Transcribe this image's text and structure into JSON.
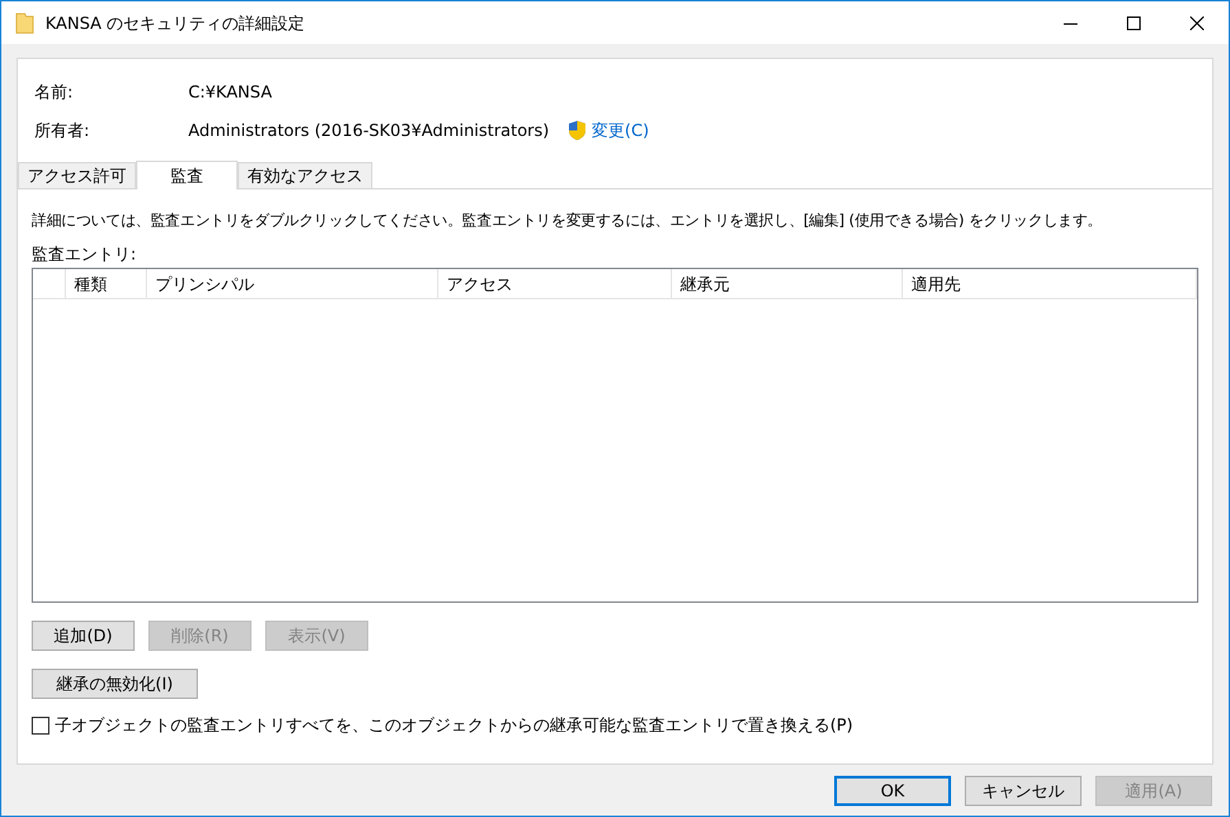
{
  "window": {
    "title": "KANSA のセキュリティの詳細設定"
  },
  "properties": [
    {
      "label": "名前:",
      "value": "C:¥KANSA"
    },
    {
      "label": "所有者:",
      "value": "Administrators (2016-SK03¥Administrators)",
      "link": "変更(C)"
    }
  ],
  "tabs": [
    {
      "label": "アクセス許可",
      "selected": false
    },
    {
      "label": "監査",
      "selected": true
    },
    {
      "label": "有効なアクセス",
      "selected": false
    }
  ],
  "description": "詳細については、監査エントリをダブルクリックしてください。監査エントリを変更するには、エントリを選択し、[編集] (使用できる場合) をクリックします。",
  "list_label": "監査エントリ:",
  "table": {
    "columns": [
      "種類",
      "プリンシパル",
      "アクセス",
      "継承元",
      "適用先"
    ]
  },
  "entry_buttons": [
    {
      "label": "追加(D)",
      "disabled": false
    },
    {
      "label": "削除(R)",
      "disabled": true
    },
    {
      "label": "表示(V)",
      "disabled": true
    }
  ],
  "inheritance_button": {
    "label": "継承の無効化(I)",
    "disabled": false
  },
  "replace_checkbox": {
    "label": "子オブジェクトの監査エントリすべてを、このオブジェクトからの継承可能な監査エントリで置き換える(P)",
    "checked": false
  },
  "footer_buttons": [
    {
      "label": "OK",
      "disabled": false,
      "default": true
    },
    {
      "label": "キャンセル",
      "disabled": false,
      "default": false
    },
    {
      "label": "適用(A)",
      "disabled": true,
      "default": false
    }
  ]
}
